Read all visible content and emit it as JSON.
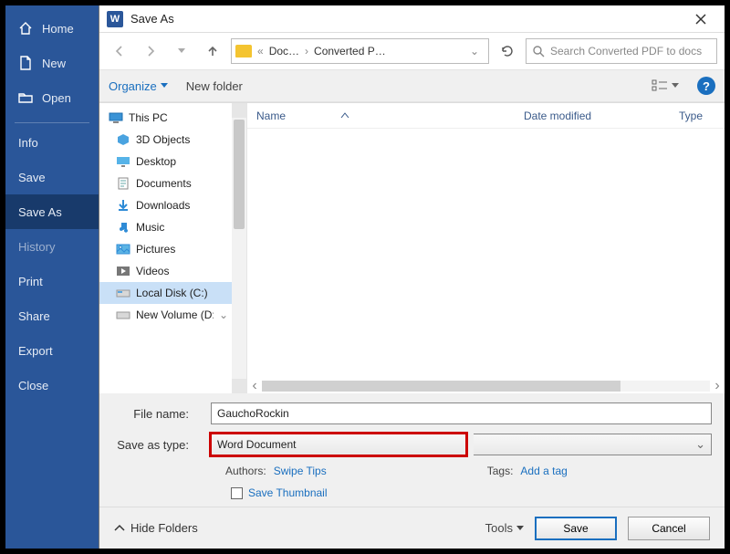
{
  "sidebar": {
    "items": [
      {
        "label": "Home",
        "icon": "home"
      },
      {
        "label": "New",
        "icon": "file"
      },
      {
        "label": "Open",
        "icon": "folder-open"
      }
    ],
    "items2": [
      {
        "label": "Info"
      },
      {
        "label": "Save"
      },
      {
        "label": "Save As",
        "selected": true
      },
      {
        "label": "History",
        "dim": true
      },
      {
        "label": "Print"
      },
      {
        "label": "Share"
      },
      {
        "label": "Export"
      },
      {
        "label": "Close"
      }
    ]
  },
  "dialog": {
    "title": "Save As",
    "breadcrumb": [
      "Doc…",
      "Converted P…"
    ],
    "search_placeholder": "Search Converted PDF to docs",
    "toolbar": {
      "organize": "Organize",
      "new_folder": "New folder"
    },
    "tree": [
      {
        "label": "This PC",
        "icon": "pc"
      },
      {
        "label": "3D Objects",
        "icon": "3d"
      },
      {
        "label": "Desktop",
        "icon": "desktop"
      },
      {
        "label": "Documents",
        "icon": "docs"
      },
      {
        "label": "Downloads",
        "icon": "down"
      },
      {
        "label": "Music",
        "icon": "music"
      },
      {
        "label": "Pictures",
        "icon": "pics"
      },
      {
        "label": "Videos",
        "icon": "video"
      },
      {
        "label": "Local Disk (C:)",
        "icon": "disk",
        "selected": true
      },
      {
        "label": "New Volume (D:",
        "icon": "disk"
      }
    ],
    "columns": {
      "name": "Name",
      "date": "Date modified",
      "type": "Type"
    },
    "form": {
      "file_name_label": "File name:",
      "file_name_value": "GauchoRockin",
      "save_type_label": "Save as type:",
      "save_type_value": "Word Document",
      "authors_label": "Authors:",
      "authors_value": "Swipe Tips",
      "tags_label": "Tags:",
      "tags_value": "Add a tag",
      "save_thumbnail": "Save Thumbnail"
    },
    "footer": {
      "hide_folders": "Hide Folders",
      "tools": "Tools",
      "save": "Save",
      "cancel": "Cancel"
    }
  }
}
